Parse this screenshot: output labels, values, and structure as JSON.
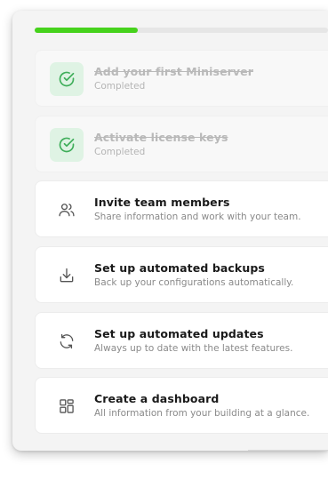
{
  "progress": {
    "fraction": 0.35,
    "color": "#46d21c"
  },
  "tasks": [
    {
      "title": "Add your first Miniserver",
      "subtitle": "Completed",
      "status": "completed",
      "icon": "check-circle-icon"
    },
    {
      "title": "Activate license keys",
      "subtitle": "Completed",
      "status": "completed",
      "icon": "check-circle-icon"
    },
    {
      "title": "Invite team members",
      "subtitle": "Share information and work with your team.",
      "status": "pending",
      "icon": "users-icon"
    },
    {
      "title": "Set up automated backups",
      "subtitle": "Back up your configurations automatically.",
      "status": "pending",
      "icon": "download-icon"
    },
    {
      "title": "Set up automated updates",
      "subtitle": "Always up to date with the latest features.",
      "status": "pending",
      "icon": "refresh-icon"
    },
    {
      "title": "Create a dashboard",
      "subtitle": "All information from your building at a glance.",
      "status": "pending",
      "icon": "dashboard-grid-icon"
    }
  ]
}
